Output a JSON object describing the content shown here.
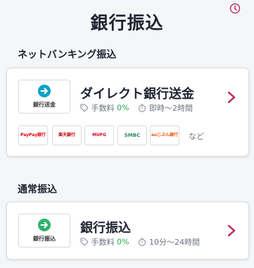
{
  "page": {
    "title": "銀行振込"
  },
  "sections": [
    {
      "label": "ネットバンキング振込"
    },
    {
      "label": "通常振込"
    }
  ],
  "methods": [
    {
      "logo_text": "銀行送金",
      "name": "ダイレクト銀行送金",
      "fee_label": "手数料",
      "fee_value": "0%",
      "time_text": "即時〜2時間",
      "accent": "#0aa0c8"
    },
    {
      "logo_text": "銀行振込",
      "name": "銀行振込",
      "fee_label": "手数料",
      "fee_value": "0%",
      "time_text": "10分〜24時間",
      "accent": "#2fb36a"
    }
  ],
  "banks": [
    {
      "name": "PayPay銀行",
      "color": "#e60012"
    },
    {
      "name": "楽天銀行",
      "color": "#bf0000"
    },
    {
      "name": "MUFG",
      "color": "#d0021b"
    },
    {
      "name": "SMBC",
      "color": "#2e8b57"
    },
    {
      "name": "auじぶん銀行",
      "color": "#eb5505"
    }
  ],
  "banks_more": "など",
  "colors": {
    "chevron": "#c2185b",
    "fee_free": "#2fa84f"
  }
}
